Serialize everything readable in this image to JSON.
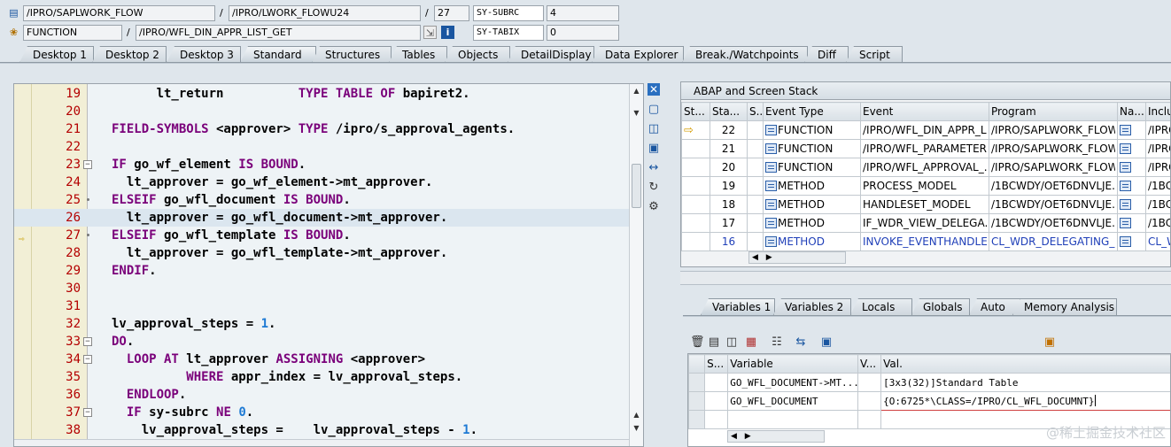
{
  "header": {
    "row1": {
      "main_program": "/IPRO/SAPLWORK_FLOW",
      "include": "/IPRO/LWORK_FLOWU24",
      "line": "27",
      "sys_field": "SY-SUBRC",
      "sys_value": "4"
    },
    "row2": {
      "event_type": "FUNCTION",
      "event": "/IPRO/WFL_DIN_APPR_LIST_GET",
      "sys_field": "SY-TABIX",
      "sys_value": "0"
    },
    "separator": "/",
    "row1_icon": "list-icon",
    "row2_icon": "debug-icon",
    "info_icon": "info-icon"
  },
  "tabs": [
    "Desktop 1",
    "Desktop 2",
    "Desktop 3",
    "Standard",
    "Structures",
    "Tables",
    "Objects",
    "DetailDisplay",
    "Data Explorer",
    "Break./Watchpoints",
    "Diff",
    "Script"
  ],
  "active_tab": "Standard",
  "editor": {
    "lines": [
      {
        "no": "19",
        "text": "      lt_return          TYPE TABLE OF bapiret2."
      },
      {
        "no": "20",
        "text": ""
      },
      {
        "no": "21",
        "text": "FIELD-SYMBOLS <approver> TYPE /ipro/s_approval_agents."
      },
      {
        "no": "22",
        "text": ""
      },
      {
        "no": "23",
        "text": "IF go_wf_element IS BOUND."
      },
      {
        "no": "24",
        "text": "  lt_approver = go_wf_element->mt_approver."
      },
      {
        "no": "25",
        "text": "ELSEIF go_wfl_document IS BOUND."
      },
      {
        "no": "26",
        "text": "  lt_approver = go_wfl_document->mt_approver."
      },
      {
        "no": "27",
        "text": "ELSEIF go_wfl_template IS BOUND."
      },
      {
        "no": "28",
        "text": "  lt_approver = go_wfl_template->mt_approver."
      },
      {
        "no": "29",
        "text": "ENDIF."
      },
      {
        "no": "30",
        "text": ""
      },
      {
        "no": "31",
        "text": ""
      },
      {
        "no": "32",
        "text": "lv_approval_steps = 1."
      },
      {
        "no": "33",
        "text": "DO."
      },
      {
        "no": "34",
        "text": "  LOOP AT lt_approver ASSIGNING <approver>"
      },
      {
        "no": "35",
        "text": "          WHERE appr_index = lv_approval_steps."
      },
      {
        "no": "36",
        "text": "  ENDLOOP."
      },
      {
        "no": "37",
        "text": "  IF sy-subrc NE 0."
      },
      {
        "no": "38",
        "text": "    lv_approval_steps =    lv_approval_steps - 1."
      }
    ],
    "current_line": "27",
    "highlighted_line": "26"
  },
  "stack": {
    "title": "ABAP and Screen Stack",
    "columns": [
      "St...",
      "Sta...",
      "S...",
      "Event Type",
      "Event",
      "Program",
      "Na...",
      "Inclu"
    ],
    "rows": [
      {
        "current": true,
        "level": "22",
        "type": "FUNCTION",
        "event": "/IPRO/WFL_DIN_APPR_L...",
        "program": "/IPRO/SAPLWORK_FLOW",
        "include": "/IPRO"
      },
      {
        "current": false,
        "level": "21",
        "type": "FUNCTION",
        "event": "/IPRO/WFL_PARAMETER...",
        "program": "/IPRO/SAPLWORK_FLOW",
        "include": "/IPRO"
      },
      {
        "current": false,
        "level": "20",
        "type": "FUNCTION",
        "event": "/IPRO/WFL_APPROVAL_...",
        "program": "/IPRO/SAPLWORK_FLOW",
        "include": "/IPRO"
      },
      {
        "current": false,
        "level": "19",
        "type": "METHOD",
        "event": "PROCESS_MODEL",
        "program": "/1BCWDY/OET6DNVLJE...",
        "include": "/1BC"
      },
      {
        "current": false,
        "level": "18",
        "type": "METHOD",
        "event": "HANDLESET_MODEL",
        "program": "/1BCWDY/OET6DNVLJE...",
        "include": "/1BC"
      },
      {
        "current": false,
        "level": "17",
        "type": "METHOD",
        "event": "IF_WDR_VIEW_DELEGA...",
        "program": "/1BCWDY/OET6DNVLJE...",
        "include": "/1BC"
      },
      {
        "current": false,
        "level": "16",
        "type": "METHOD",
        "event": "INVOKE_EVENTHANDLER",
        "program": "CL_WDR_DELEGATING_...",
        "include": "CL_W"
      }
    ]
  },
  "variables": {
    "tabs": [
      "Variables 1",
      "Variables 2",
      "Locals",
      "Globals",
      "Auto",
      "Memory Analysis"
    ],
    "active_tab": "Variables 1",
    "columns": [
      "S...",
      "Variable",
      "V...",
      "Val."
    ],
    "rows": [
      {
        "variable": "GO_WFL_DOCUMENT->MT...",
        "value": "[3x3(32)]Standard Table"
      },
      {
        "variable": "GO_WFL_DOCUMENT",
        "value": "{O:6725*\\CLASS=/IPRO/CL_WFL_DOCUMNT}"
      }
    ]
  },
  "watermark": "@稀土掘金技术社区",
  "colors": {
    "keyword": "#7a007a",
    "number": "#1e7ad4",
    "line_number": "#b40000",
    "highlight": "#dbe6ef"
  }
}
